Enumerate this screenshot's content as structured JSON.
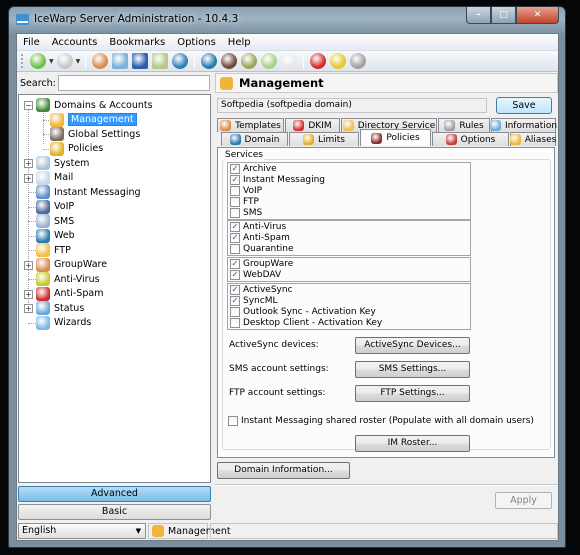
{
  "window": {
    "title": "IceWarp Server Administration - 10.4.3",
    "controls": {
      "minimize": "–",
      "maximize": "□",
      "close": "✕"
    }
  },
  "menubar": [
    "File",
    "Accounts",
    "Bookmarks",
    "Options",
    "Help"
  ],
  "toolbar": {
    "buttons": [
      {
        "icon": "back-icon",
        "color": "#6cc04a"
      },
      {
        "icon": "forward-icon",
        "color": "#c8c8c8"
      },
      {
        "icon": "groupware-icon",
        "color": "#d98b4c"
      },
      {
        "icon": "server-icon",
        "color": "#7fb2d8"
      },
      {
        "icon": "panel-icon",
        "color": "#2a5fae"
      },
      {
        "icon": "columns-icon",
        "color": "#b5c98a"
      },
      {
        "icon": "globe-settings-icon",
        "color": "#2f7fb8"
      },
      {
        "icon": "globe-icon",
        "color": "#2a7ab0"
      },
      {
        "icon": "user-icon",
        "color": "#6b4a3a"
      },
      {
        "icon": "users-icon",
        "color": "#9aa65a"
      },
      {
        "icon": "plugin-icon",
        "color": "#a8d08a"
      },
      {
        "icon": "document-icon",
        "color": "#e8e8e8"
      },
      {
        "icon": "stop-icon",
        "color": "#d42a2a"
      },
      {
        "icon": "antivirus-icon",
        "color": "#e3c92a"
      },
      {
        "icon": "filter-icon",
        "color": "#a0a0a0"
      }
    ]
  },
  "search": {
    "label": "Search:",
    "value": "",
    "placeholder": ""
  },
  "tree": {
    "items": [
      {
        "label": "Domains & Accounts",
        "icon": "globe-icon",
        "color": "#3f8a3a",
        "expander": "−",
        "level": 0
      },
      {
        "label": "Management",
        "icon": "management-icon",
        "color": "#f0b43a",
        "level": 1,
        "selected": true
      },
      {
        "label": "Global Settings",
        "icon": "user-settings-icon",
        "color": "#7a6a5a",
        "level": 1
      },
      {
        "label": "Policies",
        "icon": "lock-icon",
        "color": "#e0b020",
        "level": 1
      },
      {
        "label": "System",
        "icon": "system-icon",
        "color": "#a8c4d8",
        "expander": "+",
        "level": 0
      },
      {
        "label": "Mail",
        "icon": "mail-icon",
        "color": "#c8d8e8",
        "expander": "+",
        "level": 0
      },
      {
        "label": "Instant Messaging",
        "icon": "instant-messaging-icon",
        "color": "#5a8fc8",
        "level": 0
      },
      {
        "label": "VoIP",
        "icon": "headset-icon",
        "color": "#4a6a9a",
        "level": 0
      },
      {
        "label": "SMS",
        "icon": "phone-icon",
        "color": "#9ab4d0",
        "level": 0
      },
      {
        "label": "Web",
        "icon": "web-globe-icon",
        "color": "#2a7ab0",
        "level": 0
      },
      {
        "label": "FTP",
        "icon": "folder-icon",
        "color": "#f0c040",
        "level": 0
      },
      {
        "label": "GroupWare",
        "icon": "groupware-icon",
        "color": "#d98b4c",
        "expander": "+",
        "level": 0
      },
      {
        "label": "Anti-Virus",
        "icon": "antivirus-icon",
        "color": "#c8c82a",
        "level": 0
      },
      {
        "label": "Anti-Spam",
        "icon": "antispam-icon",
        "color": "#d42a2a",
        "expander": "+",
        "level": 0
      },
      {
        "label": "Status",
        "icon": "monitor-icon",
        "color": "#6aa8d8",
        "expander": "+",
        "level": 0
      },
      {
        "label": "Wizards",
        "icon": "wizard-icon",
        "color": "#7ab8e0",
        "level": 0
      }
    ]
  },
  "left_buttons": {
    "advanced": "Advanced",
    "basic": "Basic"
  },
  "language": {
    "selected": "English"
  },
  "header": {
    "title": "Management",
    "icon_color": "#f0b43a"
  },
  "domain_field": "Softpedia (softpedia domain)",
  "save_label": "Save",
  "tabs_row1": [
    {
      "label": "Templates",
      "icon": "templates-icon",
      "color": "#d98b4c"
    },
    {
      "label": "DKIM",
      "icon": "lock-red-icon",
      "color": "#d42a2a"
    },
    {
      "label": "Directory Service",
      "icon": "directory-icon",
      "color": "#f0c040"
    },
    {
      "label": "Rules",
      "icon": "filter-icon",
      "color": "#a0a0a0"
    },
    {
      "label": "Information",
      "icon": "monitor-icon",
      "color": "#6aa8d8"
    }
  ],
  "tabs_row2": [
    {
      "label": "Domain",
      "icon": "globe-icon",
      "color": "#2a7ab0"
    },
    {
      "label": "Limits",
      "icon": "lock-icon",
      "color": "#e0b020"
    },
    {
      "label": "Policies",
      "icon": "policies-icon",
      "color": "#8a2a2a",
      "active": true
    },
    {
      "label": "Options",
      "icon": "tools-icon",
      "color": "#c83a3a"
    },
    {
      "label": "Aliases",
      "icon": "aliases-icon",
      "color": "#f0b43a"
    }
  ],
  "services": {
    "label": "Services",
    "groups": [
      [
        {
          "label": "Archive",
          "checked": true
        },
        {
          "label": "Instant Messaging",
          "checked": true
        },
        {
          "label": "VoIP",
          "checked": false
        },
        {
          "label": "FTP",
          "checked": false
        },
        {
          "label": "SMS",
          "checked": false
        }
      ],
      [
        {
          "label": "Anti-Virus",
          "checked": true
        },
        {
          "label": "Anti-Spam",
          "checked": true
        },
        {
          "label": "Quarantine",
          "checked": false
        }
      ],
      [
        {
          "label": "GroupWare",
          "checked": true
        },
        {
          "label": "WebDAV",
          "checked": true
        }
      ],
      [
        {
          "label": "ActiveSync",
          "checked": true
        },
        {
          "label": "SyncML",
          "checked": true
        },
        {
          "label": "Outlook Sync - Activation Key",
          "checked": false
        },
        {
          "label": "Desktop Client - Activation Key",
          "checked": false
        }
      ]
    ]
  },
  "actions": [
    {
      "label": "ActiveSync devices:",
      "button": "ActiveSync Devices..."
    },
    {
      "label": "SMS account settings:",
      "button": "SMS Settings..."
    },
    {
      "label": "FTP account settings:",
      "button": "FTP Settings..."
    }
  ],
  "im_roster": {
    "checkbox_label": "Instant Messaging shared roster (Populate with all domain users)",
    "checked": false,
    "button": "IM Roster..."
  },
  "domain_info_button": "Domain Information...",
  "apply_label": "Apply",
  "statusbar": {
    "text": "Management",
    "icon_color": "#f0b43a"
  }
}
